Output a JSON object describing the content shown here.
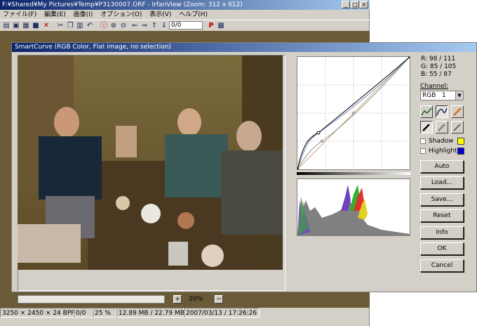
{
  "irfan": {
    "title": "F:¥Shared¥My Pictures¥Temp¥P3130007.ORF - IrfanView (Zoom: 312 x 612)",
    "window_buttons": [
      "_",
      "□",
      "×"
    ],
    "menu": [
      "ファイル(F)",
      "編集(E)",
      "画像(I)",
      "オプション(O)",
      "表示(V)",
      "ヘルプ(H)"
    ],
    "page_counter": "0/0",
    "status": {
      "dimensions": "3250 × 2450 × 24 BPP",
      "page": "0/0",
      "zoom": "25 %",
      "memory": "12.89 MB / 22.79 MB",
      "datetime": "2007/03/13 / 17:26:26"
    }
  },
  "smartcurve": {
    "title": "SmartCurve (RGB Color, Flat image, no selection)",
    "readout": {
      "r": "R: 98 / 111",
      "g": "G: 85 / 105",
      "b": "B: 55 / 87"
    },
    "channel_label": "Channel:",
    "channel_value": "RGB",
    "channel_number": "1",
    "shadow_label": "Shadow",
    "highlight_label": "Highlight",
    "shadow_color": "#ffff00",
    "highlight_color": "#0000cc",
    "buttons": [
      "Auto",
      "Load...",
      "Save...",
      "Reset",
      "Info",
      "OK",
      "Cancel"
    ],
    "zoom_value": "20%",
    "zoom_minus": "−",
    "zoom_plus": "+"
  }
}
